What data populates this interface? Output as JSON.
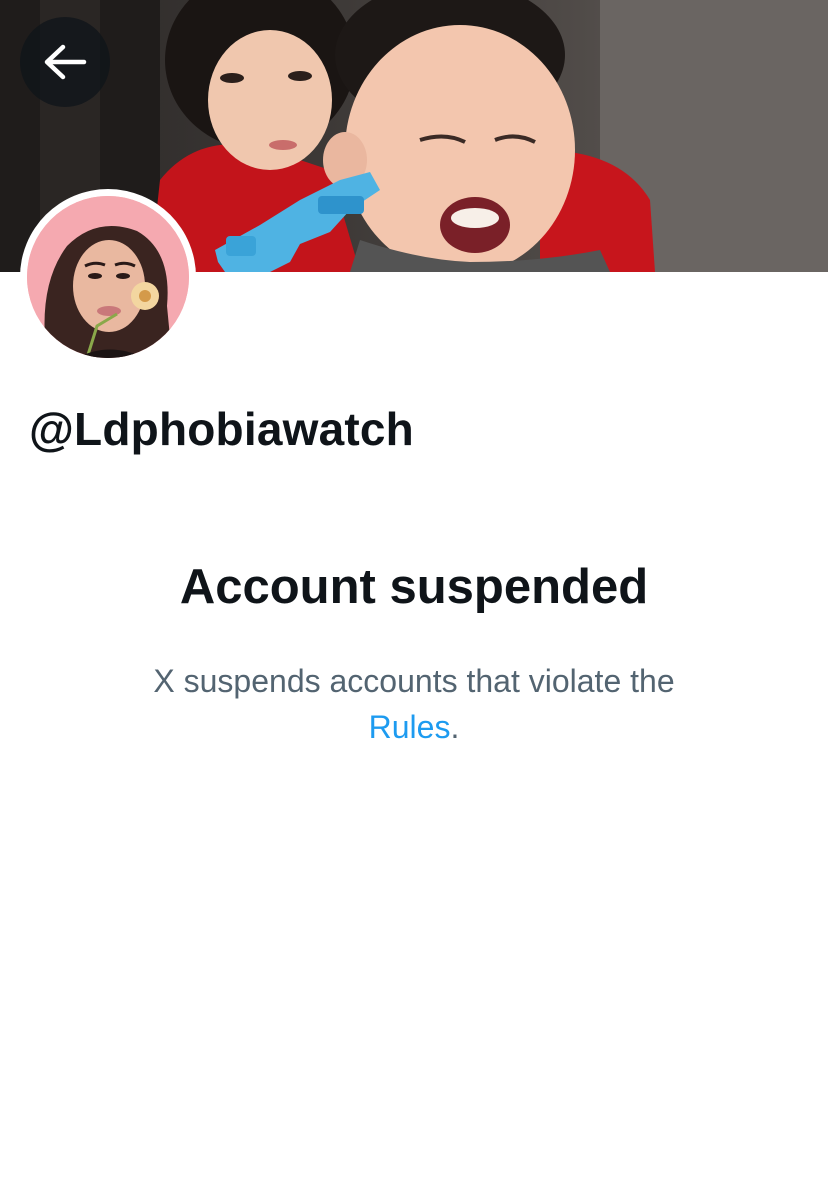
{
  "profile": {
    "handle": "@Ldphobiawatch"
  },
  "suspension": {
    "title": "Account suspended",
    "message_line1": "X suspends accounts that violate the",
    "rules_link": "Rules",
    "period": "."
  },
  "icons": {
    "back": "arrow-left-icon"
  },
  "colors": {
    "text_primary": "#0f1419",
    "text_secondary": "#536471",
    "link": "#1d9bf0",
    "avatar_bg": "#f5a9b0"
  }
}
